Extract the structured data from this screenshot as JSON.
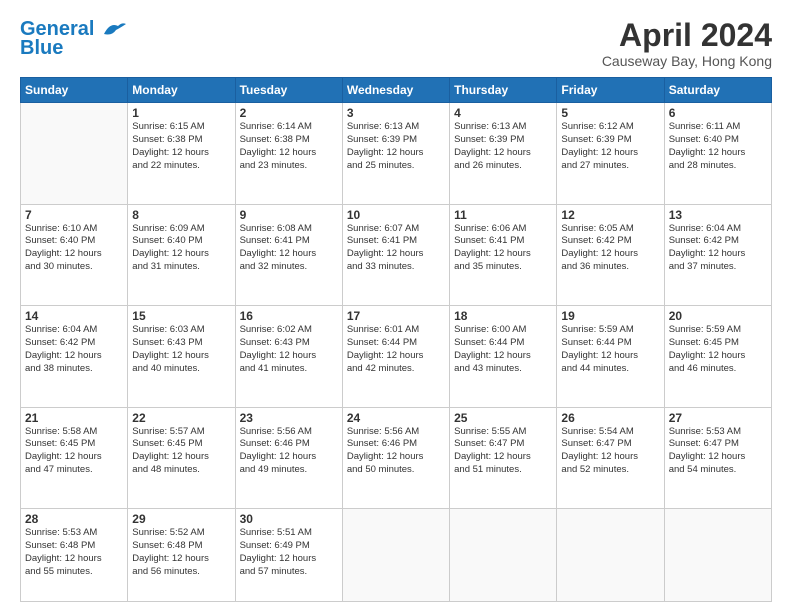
{
  "header": {
    "logo_line1": "General",
    "logo_line2": "Blue",
    "month_title": "April 2024",
    "location": "Causeway Bay, Hong Kong"
  },
  "weekdays": [
    "Sunday",
    "Monday",
    "Tuesday",
    "Wednesday",
    "Thursday",
    "Friday",
    "Saturday"
  ],
  "weeks": [
    [
      {
        "day": "",
        "info": ""
      },
      {
        "day": "1",
        "info": "Sunrise: 6:15 AM\nSunset: 6:38 PM\nDaylight: 12 hours\nand 22 minutes."
      },
      {
        "day": "2",
        "info": "Sunrise: 6:14 AM\nSunset: 6:38 PM\nDaylight: 12 hours\nand 23 minutes."
      },
      {
        "day": "3",
        "info": "Sunrise: 6:13 AM\nSunset: 6:39 PM\nDaylight: 12 hours\nand 25 minutes."
      },
      {
        "day": "4",
        "info": "Sunrise: 6:13 AM\nSunset: 6:39 PM\nDaylight: 12 hours\nand 26 minutes."
      },
      {
        "day": "5",
        "info": "Sunrise: 6:12 AM\nSunset: 6:39 PM\nDaylight: 12 hours\nand 27 minutes."
      },
      {
        "day": "6",
        "info": "Sunrise: 6:11 AM\nSunset: 6:40 PM\nDaylight: 12 hours\nand 28 minutes."
      }
    ],
    [
      {
        "day": "7",
        "info": "Sunrise: 6:10 AM\nSunset: 6:40 PM\nDaylight: 12 hours\nand 30 minutes."
      },
      {
        "day": "8",
        "info": "Sunrise: 6:09 AM\nSunset: 6:40 PM\nDaylight: 12 hours\nand 31 minutes."
      },
      {
        "day": "9",
        "info": "Sunrise: 6:08 AM\nSunset: 6:41 PM\nDaylight: 12 hours\nand 32 minutes."
      },
      {
        "day": "10",
        "info": "Sunrise: 6:07 AM\nSunset: 6:41 PM\nDaylight: 12 hours\nand 33 minutes."
      },
      {
        "day": "11",
        "info": "Sunrise: 6:06 AM\nSunset: 6:41 PM\nDaylight: 12 hours\nand 35 minutes."
      },
      {
        "day": "12",
        "info": "Sunrise: 6:05 AM\nSunset: 6:42 PM\nDaylight: 12 hours\nand 36 minutes."
      },
      {
        "day": "13",
        "info": "Sunrise: 6:04 AM\nSunset: 6:42 PM\nDaylight: 12 hours\nand 37 minutes."
      }
    ],
    [
      {
        "day": "14",
        "info": "Sunrise: 6:04 AM\nSunset: 6:42 PM\nDaylight: 12 hours\nand 38 minutes."
      },
      {
        "day": "15",
        "info": "Sunrise: 6:03 AM\nSunset: 6:43 PM\nDaylight: 12 hours\nand 40 minutes."
      },
      {
        "day": "16",
        "info": "Sunrise: 6:02 AM\nSunset: 6:43 PM\nDaylight: 12 hours\nand 41 minutes."
      },
      {
        "day": "17",
        "info": "Sunrise: 6:01 AM\nSunset: 6:44 PM\nDaylight: 12 hours\nand 42 minutes."
      },
      {
        "day": "18",
        "info": "Sunrise: 6:00 AM\nSunset: 6:44 PM\nDaylight: 12 hours\nand 43 minutes."
      },
      {
        "day": "19",
        "info": "Sunrise: 5:59 AM\nSunset: 6:44 PM\nDaylight: 12 hours\nand 44 minutes."
      },
      {
        "day": "20",
        "info": "Sunrise: 5:59 AM\nSunset: 6:45 PM\nDaylight: 12 hours\nand 46 minutes."
      }
    ],
    [
      {
        "day": "21",
        "info": "Sunrise: 5:58 AM\nSunset: 6:45 PM\nDaylight: 12 hours\nand 47 minutes."
      },
      {
        "day": "22",
        "info": "Sunrise: 5:57 AM\nSunset: 6:45 PM\nDaylight: 12 hours\nand 48 minutes."
      },
      {
        "day": "23",
        "info": "Sunrise: 5:56 AM\nSunset: 6:46 PM\nDaylight: 12 hours\nand 49 minutes."
      },
      {
        "day": "24",
        "info": "Sunrise: 5:56 AM\nSunset: 6:46 PM\nDaylight: 12 hours\nand 50 minutes."
      },
      {
        "day": "25",
        "info": "Sunrise: 5:55 AM\nSunset: 6:47 PM\nDaylight: 12 hours\nand 51 minutes."
      },
      {
        "day": "26",
        "info": "Sunrise: 5:54 AM\nSunset: 6:47 PM\nDaylight: 12 hours\nand 52 minutes."
      },
      {
        "day": "27",
        "info": "Sunrise: 5:53 AM\nSunset: 6:47 PM\nDaylight: 12 hours\nand 54 minutes."
      }
    ],
    [
      {
        "day": "28",
        "info": "Sunrise: 5:53 AM\nSunset: 6:48 PM\nDaylight: 12 hours\nand 55 minutes."
      },
      {
        "day": "29",
        "info": "Sunrise: 5:52 AM\nSunset: 6:48 PM\nDaylight: 12 hours\nand 56 minutes."
      },
      {
        "day": "30",
        "info": "Sunrise: 5:51 AM\nSunset: 6:49 PM\nDaylight: 12 hours\nand 57 minutes."
      },
      {
        "day": "",
        "info": ""
      },
      {
        "day": "",
        "info": ""
      },
      {
        "day": "",
        "info": ""
      },
      {
        "day": "",
        "info": ""
      }
    ]
  ]
}
